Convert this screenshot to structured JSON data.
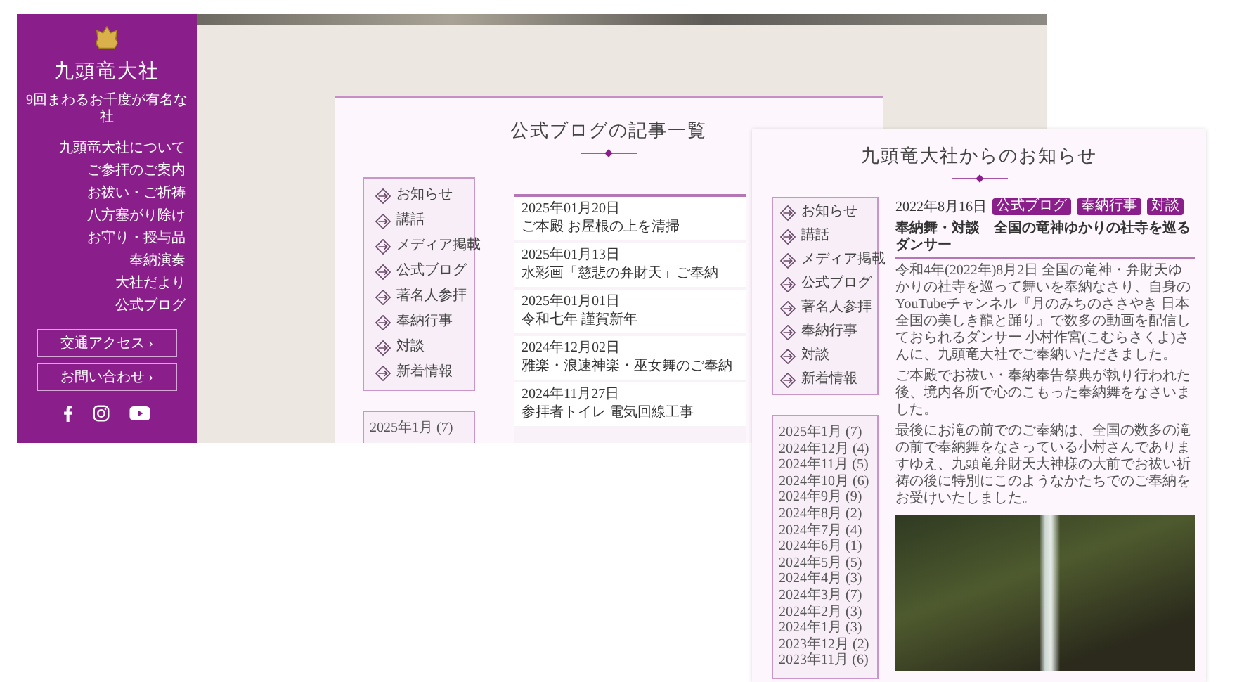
{
  "desktop_page": {
    "sidebar": {
      "site_title": "九頭竜大社",
      "tagline": "9回まわるお千度が有名な社",
      "menu": [
        {
          "label": "九頭竜大社について"
        },
        {
          "label": "ご参拝のご案内"
        },
        {
          "label": "お祓い・ご祈祷"
        },
        {
          "label": "八方塞がり除け"
        },
        {
          "label": "お守り・授与品"
        },
        {
          "label": "奉納演奏"
        },
        {
          "label": "大社だより"
        },
        {
          "label": "公式ブログ"
        }
      ],
      "buttons": [
        {
          "label": "交通アクセス ›"
        },
        {
          "label": "お問い合わせ ›"
        }
      ]
    },
    "blog_list": {
      "title": "公式ブログの記事一覧",
      "categories": [
        "お知らせ",
        "講話",
        "メディア掲載",
        "公式ブログ",
        "著名人参拝",
        "奉納行事",
        "対談",
        "新着情報"
      ],
      "archive": [
        "2025年1月 (7)"
      ],
      "posts": [
        {
          "date": "2025年01月20日",
          "title": "ご本殿 お屋根の上を清掃"
        },
        {
          "date": "2025年01月13日",
          "title": "水彩画「慈悲の弁財天」ご奉納"
        },
        {
          "date": "2025年01月01日",
          "title": "令和七年 謹賀新年"
        },
        {
          "date": "2024年12月02日",
          "title": "雅楽・浪速神楽・巫女舞のご奉納"
        },
        {
          "date": "2024年11月27日",
          "title": "参拝者トイレ 電気回線工事"
        }
      ]
    }
  },
  "notice_page": {
    "title": "九頭竜大社からのお知らせ",
    "categories": [
      "お知らせ",
      "講話",
      "メディア掲載",
      "公式ブログ",
      "著名人参拝",
      "奉納行事",
      "対談",
      "新着情報"
    ],
    "archive": [
      "2025年1月 (7)",
      "2024年12月 (4)",
      "2024年11月 (5)",
      "2024年10月 (6)",
      "2024年9月 (9)",
      "2024年8月 (2)",
      "2024年7月 (4)",
      "2024年6月 (1)",
      "2024年5月 (5)",
      "2024年4月 (3)",
      "2024年3月 (7)",
      "2024年2月 (3)",
      "2024年1月 (3)",
      "2023年12月 (2)",
      "2023年11月 (6)"
    ],
    "article": {
      "date": "2022年8月16日",
      "tags": [
        "公式ブログ",
        "奉納行事",
        "対談"
      ],
      "heading": "奉納舞・対談　全国の竜神ゆかりの社寺を巡るダンサー",
      "paragraphs": [
        "令和4年(2022年)8月2日 全国の竜神・弁財天ゆかりの社寺を巡って舞いを奉納なさり、自身のYouTubeチャンネル『月のみちのささやき 日本全国の美しき龍と踊り』で数多の動画を配信しておられるダンサー 小村作宮(こむらさくよ)さんに、九頭竜大社でご奉納いただきました。",
        "ご本殿でお祓い・奉納奉告祭典が執り行われた後、境内各所で心のこもった奉納舞をなさいました。",
        "最後にお滝の前でのご奉納は、全国の数多の滝の前で奉納舞をなさっている小村さんでありますゆえ、九頭竜弁財天大神様の大前でお祓い祈祷の後に特別にこのようなかたちでのご奉納をお受けいたしました。"
      ]
    }
  }
}
